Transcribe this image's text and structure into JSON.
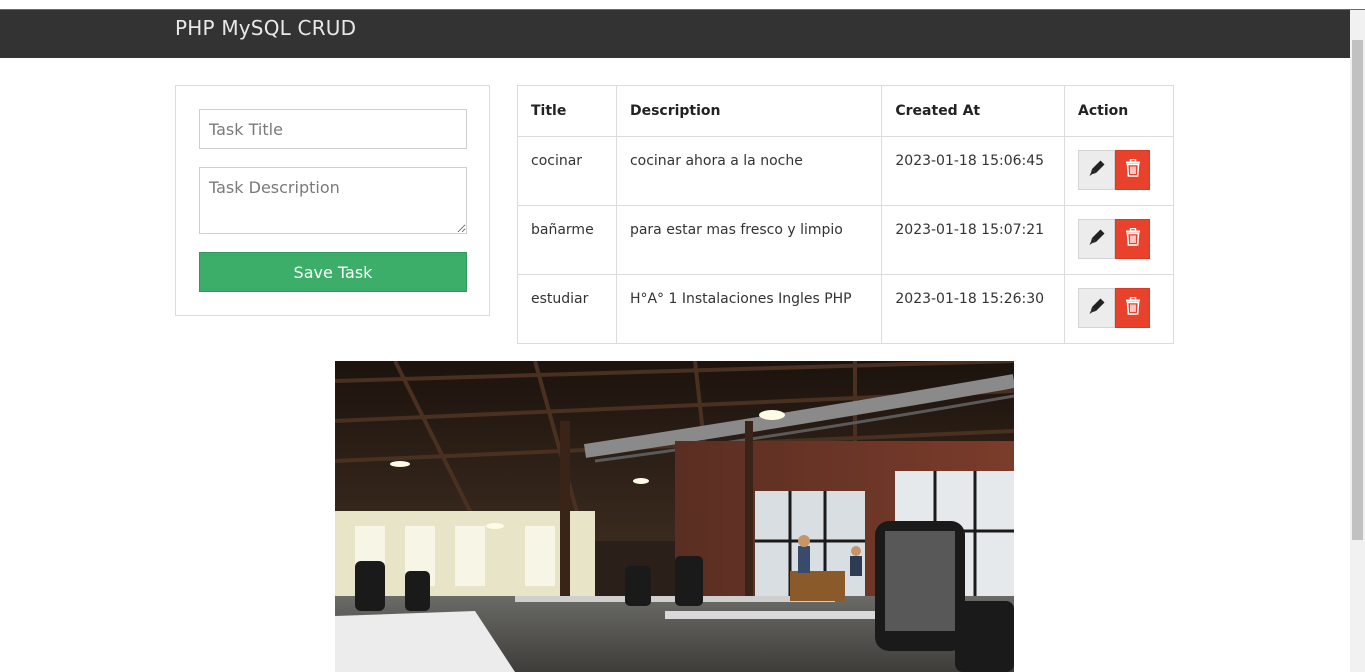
{
  "navbar": {
    "brand": "PHP MySQL CRUD"
  },
  "form": {
    "title_placeholder": "Task Title",
    "title_value": "",
    "description_placeholder": "Task Description",
    "description_value": "",
    "save_label": "Save Task"
  },
  "table": {
    "headers": [
      "Title",
      "Description",
      "Created At",
      "Action"
    ],
    "rows": [
      {
        "title": "cocinar",
        "description": "cocinar ahora a la noche",
        "created_at": "2023-01-18 15:06:45"
      },
      {
        "title": "bañarme",
        "description": "para estar mas fresco y limpio",
        "created_at": "2023-01-18 15:07:21"
      },
      {
        "title": "estudiar",
        "description": "H°A° 1 Instalaciones Ingles PHP",
        "created_at": "2023-01-18 15:26:30"
      }
    ],
    "action_icons": {
      "edit": "marker-icon",
      "delete": "trash-icon"
    }
  },
  "colors": {
    "navbar": "#333333",
    "save_button": "#3cae6a",
    "delete_button": "#e8412c",
    "edit_button": "#ececec"
  }
}
